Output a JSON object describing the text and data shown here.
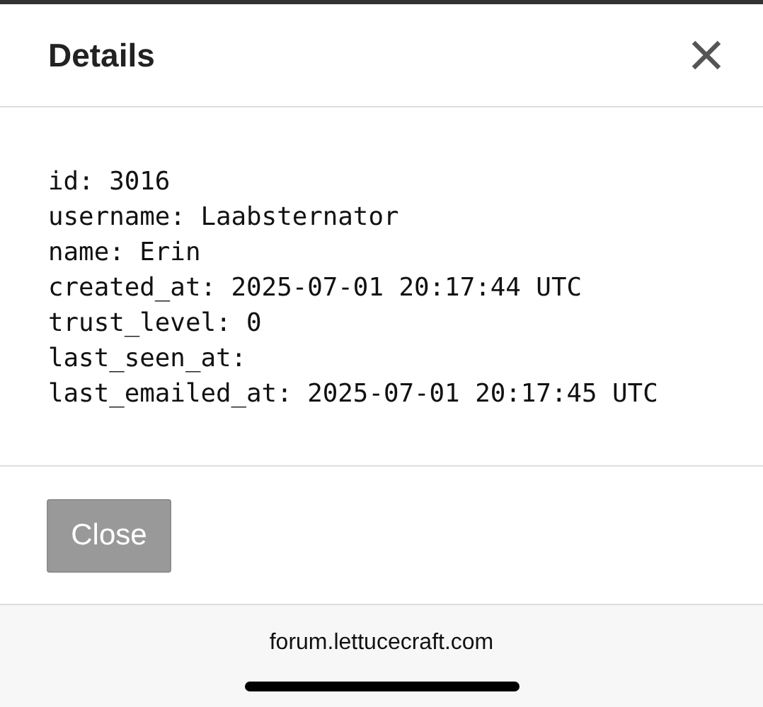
{
  "dialog": {
    "title": "Details",
    "lines": [
      "id: 3016",
      "username: Laabsternator",
      "name: Erin",
      "created_at: 2025-07-01 20:17:44 UTC",
      "trust_level: 0",
      "last_seen_at:",
      "last_emailed_at: 2025-07-01 20:17:45 UTC"
    ],
    "button": "Close"
  },
  "browser": {
    "url": "forum.lettucecraft.com"
  }
}
